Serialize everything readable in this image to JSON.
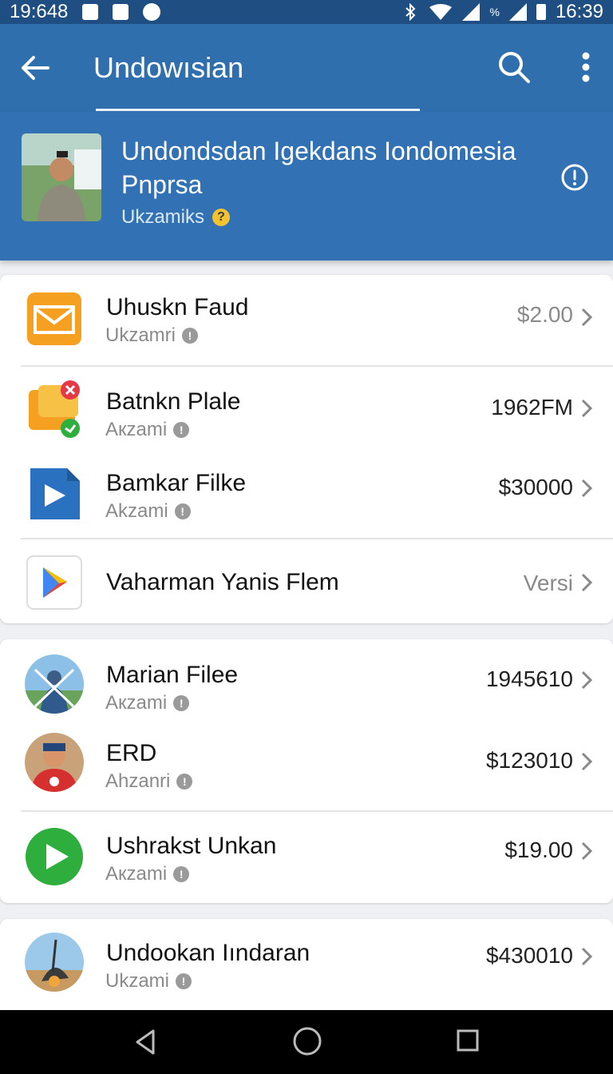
{
  "status_bar": {
    "left_time": "19:648",
    "right_time": "16:39",
    "signal_label": "%"
  },
  "app_bar": {
    "title": "Undowısian"
  },
  "profile": {
    "name": "Undondsdan Igekdans Iondomesia Pnprsa",
    "subtitle": "Ukzamiks"
  },
  "groups": [
    {
      "items": [
        {
          "title": "Uhuskn Faud",
          "subtitle": "Ukzamri",
          "value": "$2.00",
          "icon": "mail-icon"
        },
        {
          "title": "Batnkn Plale",
          "subtitle": "Aкzami",
          "value": "1962FM",
          "icon": "folder-icon"
        },
        {
          "title": "Bamkar Filke",
          "subtitle": "Akzami",
          "value": "$30000",
          "icon": "play-file-icon"
        },
        {
          "title": "Vaharman Yanis Flem",
          "subtitle": "",
          "value": "Versi",
          "icon": "play-store-icon"
        }
      ]
    },
    {
      "items": [
        {
          "title": "Marian Filee",
          "subtitle": "Aкzami",
          "value": "1945610",
          "icon": "avatar-icon"
        },
        {
          "title": "ERD",
          "subtitle": "Ahzanri",
          "value": "$123010",
          "icon": "avatar-icon"
        },
        {
          "title": "Ushrakst Unkan",
          "subtitle": "Aкzami",
          "value": "$19.00",
          "icon": "play-circle-icon"
        }
      ]
    },
    {
      "items": [
        {
          "title": "Undookan Iındaran",
          "subtitle": "Ukzami",
          "value": "$430010",
          "icon": "avatar-icon"
        }
      ]
    }
  ],
  "colors": {
    "status_bar": "#1f4e82",
    "app_bar": "#2f6fae",
    "profile_bg": "#3272b4",
    "accent_orange": "#f5a020",
    "accent_green": "#2eae3d"
  }
}
